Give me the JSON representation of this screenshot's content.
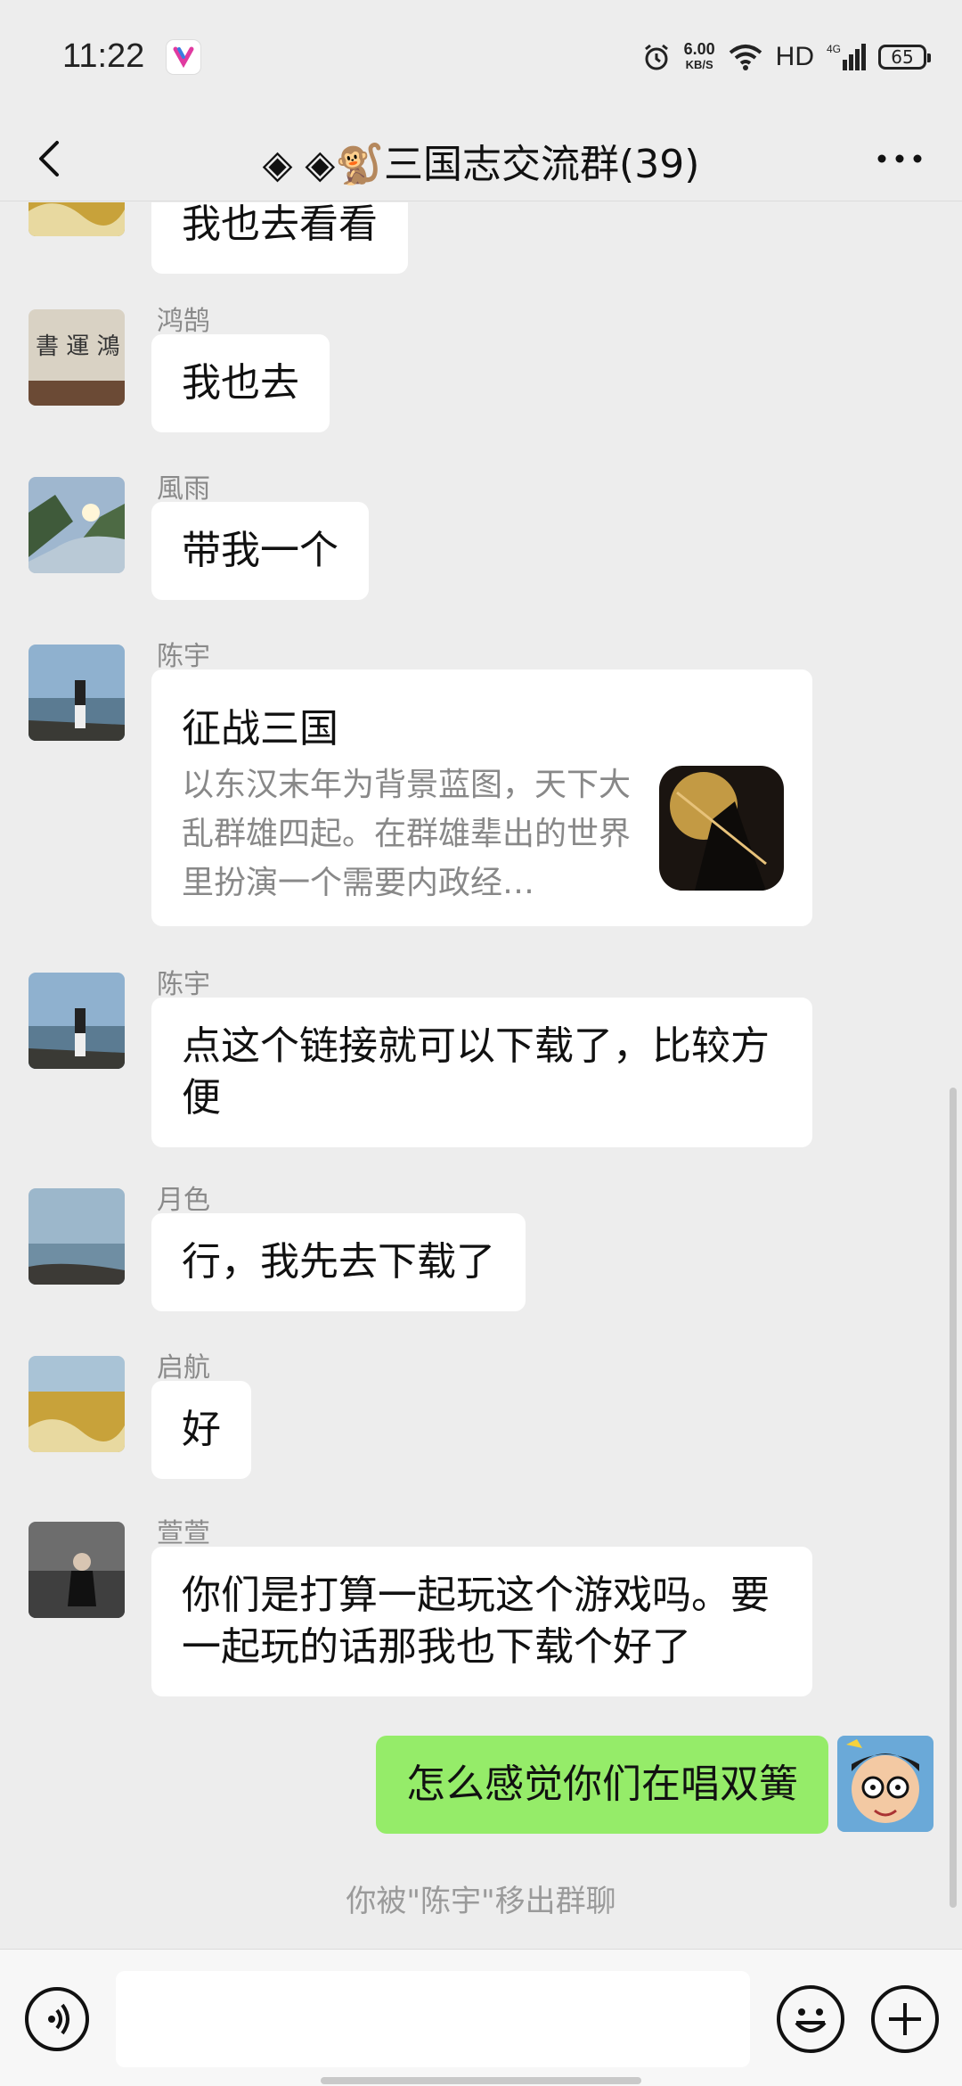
{
  "status_bar": {
    "time": "11:22",
    "app_icon_label": "YOUYU",
    "net_speed": "6.00",
    "net_unit": "KB/S",
    "hd": "HD",
    "net_type": "4G",
    "battery": "65"
  },
  "header": {
    "title": "◈ ◈🐒三国志交流群(39)"
  },
  "messages": [
    {
      "type": "text",
      "name": "",
      "text": "我也去看看"
    },
    {
      "type": "text",
      "name": "鸿鹄",
      "text": "我也去"
    },
    {
      "type": "text",
      "name": "風雨",
      "text": "带我一个"
    },
    {
      "type": "card",
      "name": "陈宇",
      "title": "征战三国",
      "desc": "以东汉末年为背景蓝图，天下大乱群雄四起。在群雄辈出的世界里扮演一个需要内政经…"
    },
    {
      "type": "text",
      "name": "陈宇",
      "text": "点这个链接就可以下载了，比较方便"
    },
    {
      "type": "text",
      "name": "月色",
      "text": "行，我先去下载了"
    },
    {
      "type": "text",
      "name": "启航",
      "text": "好"
    },
    {
      "type": "text",
      "name": "萱萱",
      "text": "你们是打算一起玩这个游戏吗。要一起玩的话那我也下载个好了"
    },
    {
      "type": "text",
      "name": "",
      "text": "怎么感觉你们在唱双簧",
      "me": true
    }
  ],
  "system_message": "你被\"陈宇\"移出群聊",
  "input": {
    "placeholder": ""
  },
  "colors": {
    "me_bubble": "#95ec69",
    "background": "#ededed"
  }
}
